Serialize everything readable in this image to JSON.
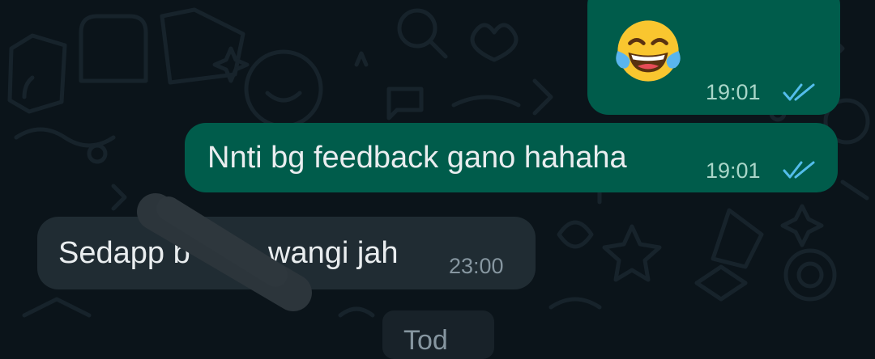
{
  "conversation": {
    "messages": [
      {
        "direction": "outgoing",
        "type": "emoji",
        "emoji_name": "face-with-tears-of-joy",
        "time": "19:01",
        "status": "read"
      },
      {
        "direction": "outgoing",
        "type": "text",
        "text": "Nnti bg feedback gano hahaha",
        "time": "19:01",
        "status": "read"
      },
      {
        "direction": "incoming",
        "type": "text",
        "text_part1": "Sedapp b",
        "text_part2": "wangi jah",
        "time": "23:00",
        "partially_obscured": true
      }
    ],
    "date_chip": "Tod"
  },
  "colors": {
    "background": "#0b141a",
    "outgoing_bubble": "#005c4b",
    "incoming_bubble": "#202c33",
    "read_ticks": "#53bdeb"
  }
}
